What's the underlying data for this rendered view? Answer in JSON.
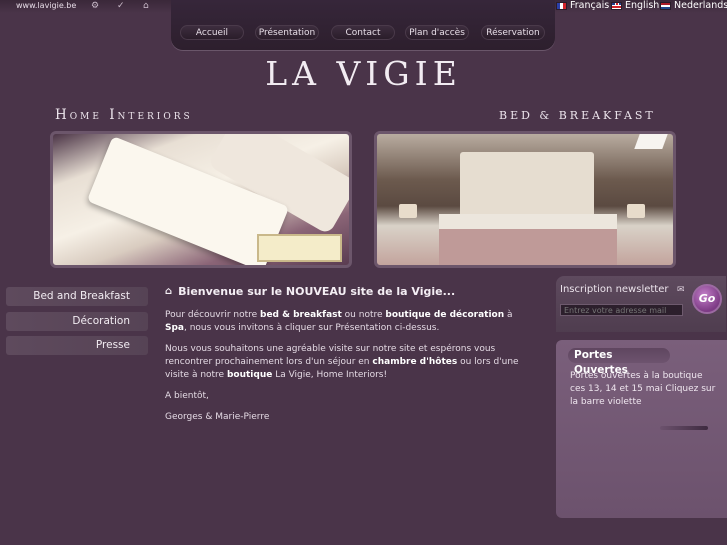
{
  "topbar": {
    "site_url": "www.lavigie.be",
    "icons": [
      "settings-icon",
      "check-icon",
      "home-icon"
    ],
    "languages": [
      {
        "label": "Français",
        "flag": "fr"
      },
      {
        "label": "English",
        "flag": "en"
      },
      {
        "label": "Nederlands",
        "flag": "nl"
      }
    ]
  },
  "nav": {
    "items": [
      "Accueil",
      "Présentation",
      "Contact",
      "Plan d'accès",
      "Réservation"
    ]
  },
  "header": {
    "logo": "LA VIGIE",
    "left_subtitle": "Home Interiors",
    "right_subtitle": "BED & BREAKFAST"
  },
  "sidebar": {
    "items": [
      "Bed and Breakfast",
      "Décoration",
      "Presse"
    ]
  },
  "main": {
    "title": "Bienvenue sur le NOUVEAU site de la Vigie...",
    "p1_a": "Pour découvrir notre ",
    "p1_b": "bed & breakfast",
    "p1_c": " ou notre ",
    "p1_d": "boutique de décoration",
    "p1_e": " à ",
    "p1_f": "Spa",
    "p1_g": ", nous vous invitons à cliquer sur Présentation ci-dessus.",
    "p2_a": "Nous vous souhaitons une agréable visite sur notre site et espérons vous rencontrer prochainement lors d'un séjour en ",
    "p2_b": "chambre d'hôtes",
    "p2_c": " ou lors d'une visite à notre ",
    "p2_d": "boutique",
    "p2_e": " La Vigie, Home Interiors!",
    "p3": "A bientôt,",
    "p4": "Georges & Marie-Pierre"
  },
  "newsletter": {
    "label": "Inscription newsletter",
    "placeholder": "Entrez votre adresse mail",
    "button": "Go"
  },
  "promo": {
    "title": "Portes Ouvertes",
    "text": "Portes ouvertes à la boutique ces 13, 14 et 15 mai Cliquez sur la barre violette"
  },
  "colors": {
    "background": "#4a3449",
    "accent": "#7d3b85"
  }
}
